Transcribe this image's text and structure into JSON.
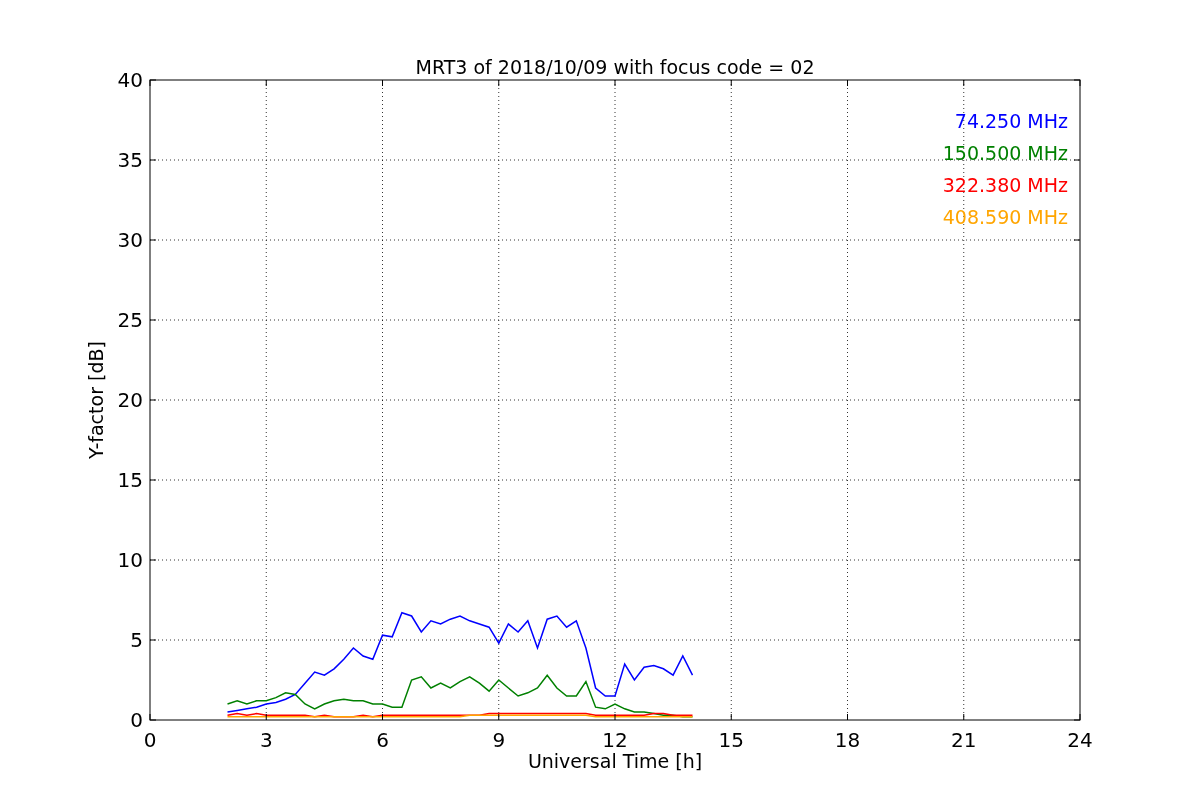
{
  "chart_data": {
    "type": "line",
    "title": "MRT3 of 2018/10/09 with focus code = 02",
    "xlabel": "Universal Time [h]",
    "ylabel": "Y-factor [dB]",
    "x": [
      2,
      2.25,
      2.5,
      2.75,
      3,
      3.25,
      3.5,
      3.75,
      4,
      4.25,
      4.5,
      4.75,
      5,
      5.25,
      5.5,
      5.75,
      6,
      6.25,
      6.5,
      6.75,
      7,
      7.25,
      7.5,
      7.75,
      8,
      8.25,
      8.5,
      8.75,
      9,
      9.25,
      9.5,
      9.75,
      10,
      10.25,
      10.5,
      10.75,
      11,
      11.25,
      11.5,
      11.75,
      12,
      12.25,
      12.5,
      12.75,
      13,
      13.25,
      13.5,
      13.75,
      14
    ],
    "series": [
      {
        "name": "74.250 MHz",
        "color": "#0000ff",
        "values": [
          0.5,
          0.6,
          0.7,
          0.8,
          1.0,
          1.1,
          1.3,
          1.6,
          2.3,
          3.0,
          2.8,
          3.2,
          3.8,
          4.5,
          4.0,
          3.8,
          5.3,
          5.2,
          6.7,
          6.5,
          5.5,
          6.2,
          6.0,
          6.3,
          6.5,
          6.2,
          6.0,
          5.8,
          4.8,
          6.0,
          5.5,
          6.2,
          4.5,
          6.3,
          6.5,
          5.8,
          6.2,
          4.5,
          2.0,
          1.5,
          1.5,
          3.5,
          2.5,
          3.3,
          3.4,
          3.2,
          2.8,
          4.0,
          2.8
        ]
      },
      {
        "name": "150.500 MHz",
        "color": "#008000",
        "values": [
          1.0,
          1.2,
          1.0,
          1.2,
          1.2,
          1.4,
          1.7,
          1.6,
          1.0,
          0.7,
          1.0,
          1.2,
          1.3,
          1.2,
          1.2,
          1.0,
          1.0,
          0.8,
          0.8,
          2.5,
          2.7,
          2.0,
          2.3,
          2.0,
          2.4,
          2.7,
          2.3,
          1.8,
          2.5,
          2.0,
          1.5,
          1.7,
          2.0,
          2.8,
          2.0,
          1.5,
          1.5,
          2.4,
          0.8,
          0.7,
          1.0,
          0.7,
          0.5,
          0.5,
          0.4,
          0.3,
          0.3,
          0.2,
          0.2
        ]
      },
      {
        "name": "322.380 MHz",
        "color": "#ff0000",
        "values": [
          0.3,
          0.4,
          0.3,
          0.4,
          0.3,
          0.3,
          0.3,
          0.3,
          0.3,
          0.2,
          0.3,
          0.2,
          null,
          0.2,
          0.3,
          0.2,
          0.3,
          0.3,
          0.3,
          0.3,
          0.3,
          0.3,
          0.3,
          0.3,
          0.3,
          0.3,
          0.3,
          0.4,
          0.4,
          0.4,
          0.4,
          0.4,
          0.4,
          0.4,
          0.4,
          0.4,
          0.4,
          0.4,
          0.3,
          0.3,
          0.3,
          0.3,
          0.3,
          0.3,
          0.4,
          0.4,
          0.3,
          0.3,
          0.3
        ]
      },
      {
        "name": "408.590 MHz",
        "color": "#ffa500",
        "values": [
          0.2,
          0.2,
          0.2,
          0.2,
          0.2,
          0.2,
          0.2,
          0.2,
          0.2,
          0.2,
          0.2,
          0.2,
          0.2,
          0.2,
          0.2,
          0.2,
          0.2,
          0.2,
          0.2,
          0.2,
          0.2,
          0.2,
          0.2,
          0.2,
          0.2,
          0.3,
          0.3,
          0.3,
          0.3,
          0.3,
          0.3,
          0.3,
          0.3,
          0.3,
          0.3,
          0.3,
          0.3,
          0.3,
          0.2,
          0.2,
          0.2,
          0.2,
          0.2,
          0.2,
          0.2,
          0.2,
          0.2,
          0.2,
          0.2
        ]
      }
    ],
    "grid": true,
    "xlim": [
      0,
      24
    ],
    "ylim": [
      0,
      40
    ],
    "xticks": [
      0,
      3,
      6,
      9,
      12,
      15,
      18,
      21,
      24
    ],
    "yticks": [
      0,
      5,
      10,
      15,
      20,
      25,
      30,
      35,
      40
    ]
  }
}
